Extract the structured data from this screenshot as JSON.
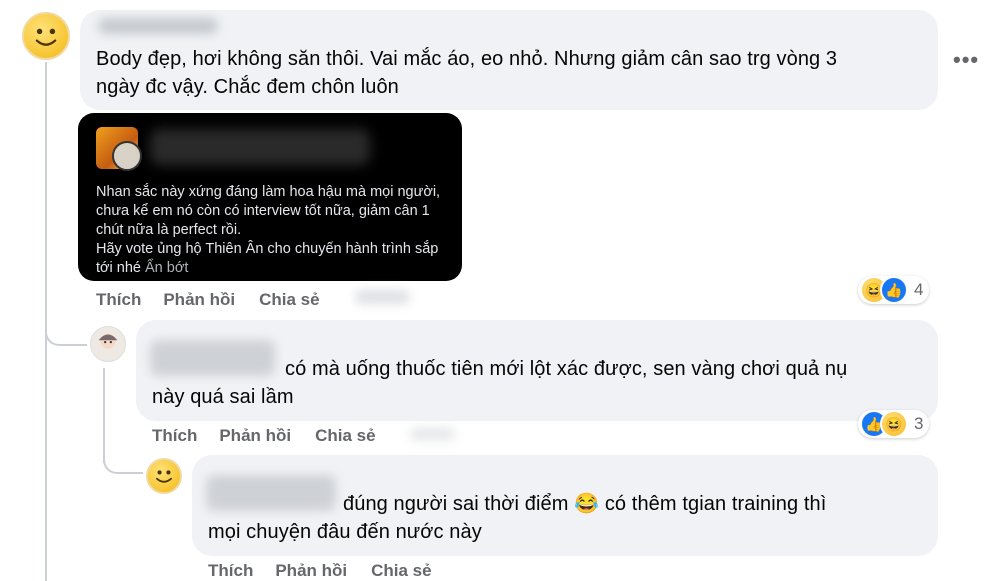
{
  "comments": [
    {
      "text": "Body đẹp, hơi không săn thôi. Vai mắc áo, eo nhỏ. Nhưng giảm cân sao trg vòng 3 ngày đc vậy. Chắc đem chôn luôn",
      "line1": "Body đẹp, hơi không săn thôi. Vai mắc áo, eo nhỏ. Nhưng giảm cân sao trg vòng 3",
      "line2": "ngày đc vậy. Chắc đem chôn luôn",
      "attachment": {
        "lines": [
          "Nhan sắc này xứng đáng làm hoa hậu mà mọi người,",
          "chưa kể em nó còn có interview tốt nữa, giảm cân 1",
          "chút nữa là perfect rồi.",
          "Hãy vote ủng hộ Thiên Ân cho chuyến hành trình sắp"
        ],
        "last_line": "tới nhé",
        "see_less": "Ẩn bớt"
      },
      "actions": {
        "like": "Thích",
        "reply": "Phản hồi",
        "share": "Chia sẻ"
      },
      "reactions": {
        "icons": [
          "haha-icon",
          "like-icon"
        ],
        "count": "4"
      },
      "more_label": "•••"
    },
    {
      "line1": "có mà uống thuốc tiên mới lột xác được, sen vàng chơi quả nụ",
      "line2": "này quá sai lầm",
      "actions": {
        "like": "Thích",
        "reply": "Phản hồi",
        "share": "Chia sẻ"
      },
      "reactions": {
        "icons": [
          "like-icon",
          "haha-icon"
        ],
        "count": "3"
      }
    },
    {
      "line1_a": "đúng người sai thời điểm",
      "emoji": "😂",
      "line1_b": "có thêm tgian training thì",
      "line2": "mọi chuyện đâu đến nước này",
      "actions": {
        "like": "Thích",
        "reply": "Phản hồi",
        "share": "Chia sẻ"
      }
    }
  ]
}
